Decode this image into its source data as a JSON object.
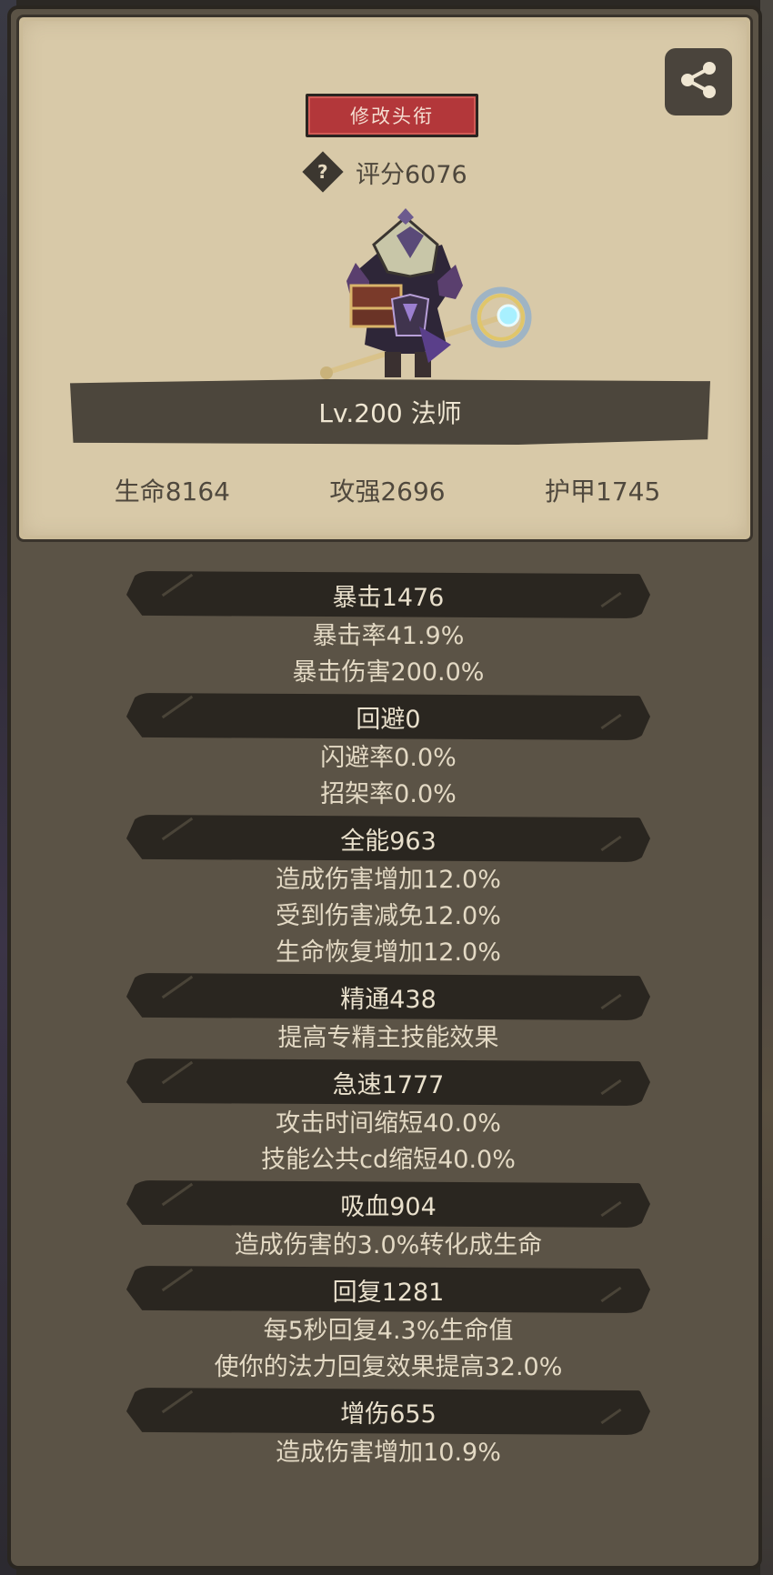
{
  "header": {
    "edit_title_label": "修改头衔",
    "score_label": "评分6076",
    "help_icon_label": "?",
    "share_icon": "share-icon"
  },
  "character": {
    "level_class": "Lv.200 法师"
  },
  "basic_stats": [
    {
      "label": "生命8164"
    },
    {
      "label": "攻强2696"
    },
    {
      "label": "护甲1745"
    }
  ],
  "stat_groups": [
    {
      "title": "暴击1476",
      "details": [
        "暴击率41.9%",
        "暴击伤害200.0%"
      ]
    },
    {
      "title": "回避0",
      "details": [
        "闪避率0.0%",
        "招架率0.0%"
      ]
    },
    {
      "title": "全能963",
      "details": [
        "造成伤害增加12.0%",
        "受到伤害减免12.0%",
        "生命恢复增加12.0%"
      ]
    },
    {
      "title": "精通438",
      "details": [
        "提高专精主技能效果"
      ]
    },
    {
      "title": "急速1777",
      "details": [
        "攻击时间缩短40.0%",
        "技能公共cd缩短40.0%"
      ]
    },
    {
      "title": "吸血904",
      "details": [
        "造成伤害的3.0%转化成生命"
      ]
    },
    {
      "title": "回复1281",
      "details": [
        "每5秒回复4.3%生命值",
        "使你的法力回复效果提高32.0%"
      ]
    },
    {
      "title": "增伤655",
      "details": [
        "造成伤害增加10.9%"
      ]
    }
  ],
  "colors": {
    "panel_bg": "#5b5346",
    "card_bg": "#d8c9a8",
    "title_button": "#b3373a",
    "header_pill": "#2a2620"
  }
}
